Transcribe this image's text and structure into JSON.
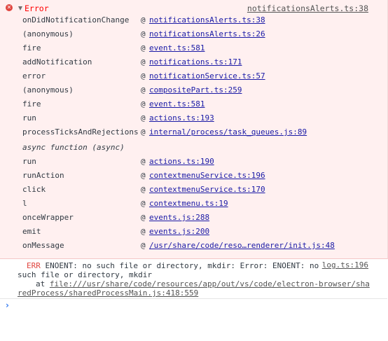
{
  "error": {
    "title": "Error",
    "source": "notificationsAlerts.ts:38",
    "frames": [
      {
        "fn": "onDidNotificationChange",
        "at": "@",
        "loc": "notificationsAlerts.ts:38"
      },
      {
        "fn": "(anonymous)",
        "at": "@",
        "loc": "notificationsAlerts.ts:26"
      },
      {
        "fn": "fire",
        "at": "@",
        "loc": "event.ts:581"
      },
      {
        "fn": "addNotification",
        "at": "@",
        "loc": "notifications.ts:171"
      },
      {
        "fn": "error",
        "at": "@",
        "loc": "notificationService.ts:57"
      },
      {
        "fn": "(anonymous)",
        "at": "@",
        "loc": "compositePart.ts:259"
      },
      {
        "fn": "fire",
        "at": "@",
        "loc": "event.ts:581"
      },
      {
        "fn": "run",
        "at": "@",
        "loc": "actions.ts:193"
      },
      {
        "fn": "processTicksAndRejections",
        "at": "@",
        "loc": "internal/process/task_queues.js:89"
      }
    ],
    "async_label": "async function (async)",
    "async_frames": [
      {
        "fn": "run",
        "at": "@",
        "loc": "actions.ts:190"
      },
      {
        "fn": "runAction",
        "at": "@",
        "loc": "contextmenuService.ts:196"
      },
      {
        "fn": "click",
        "at": "@",
        "loc": "contextmenuService.ts:170"
      },
      {
        "fn": "l",
        "at": "@",
        "loc": "contextmenu.ts:19"
      },
      {
        "fn": "onceWrapper",
        "at": "@",
        "loc": "events.js:288"
      },
      {
        "fn": "emit",
        "at": "@",
        "loc": "events.js:200"
      },
      {
        "fn": "onMessage",
        "at": "@",
        "loc": "/usr/share/code/reso…renderer/init.js:48"
      }
    ]
  },
  "message": {
    "prefix": "ERR",
    "line1": " ENOENT: no such file or directory, mkdir: Error: ENOENT: no",
    "line2": "such file or directory, mkdir",
    "line3_prefix": "at ",
    "line3_link": "file:///usr/share/code/resources/app/out/vs/code/electron-browser/sha",
    "line4_link": "redProcess/sharedProcessMain.js:418:559",
    "source": "log.ts:196"
  },
  "prompt": {
    "icon": "chevron-right-icon",
    "glyph": "›"
  },
  "colors": {
    "error_bg": "#fff0f0",
    "error_text": "#ff0000",
    "link": "#1a1aa6",
    "prompt": "#367cf1"
  }
}
